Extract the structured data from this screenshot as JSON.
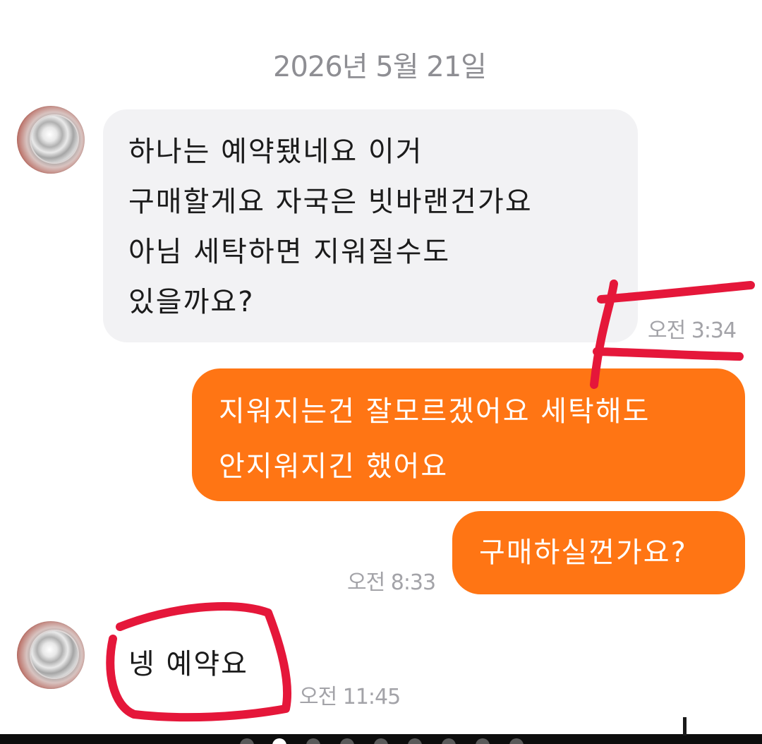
{
  "date_separator": "2026년 5월 21일",
  "messages": [
    {
      "sender": "other",
      "text": "하나는 예약됐네요 이거\n구매할게요 자국은 빗바랜건가요\n아님 세탁하면 지워질수도\n있을까요?",
      "time": "오전 3:34"
    },
    {
      "sender": "me",
      "text": "지워지는건 잘모르겠어요 세탁해도\n안지워지긴 했어요",
      "time": ""
    },
    {
      "sender": "me",
      "text": "구매하실껀가요?",
      "time": "오전 8:33"
    },
    {
      "sender": "other",
      "text": "넹 예약요",
      "time": "오전 11:45"
    }
  ],
  "page_indicator": {
    "total": 9,
    "active_index": 1
  },
  "colors": {
    "incoming_bubble": "#f2f2f4",
    "outgoing_bubble": "#ff7514",
    "annotation_red": "#e5173a",
    "timestamp": "#a3a3a8"
  },
  "icons": {
    "avatar": "coin-avatar-icon"
  }
}
